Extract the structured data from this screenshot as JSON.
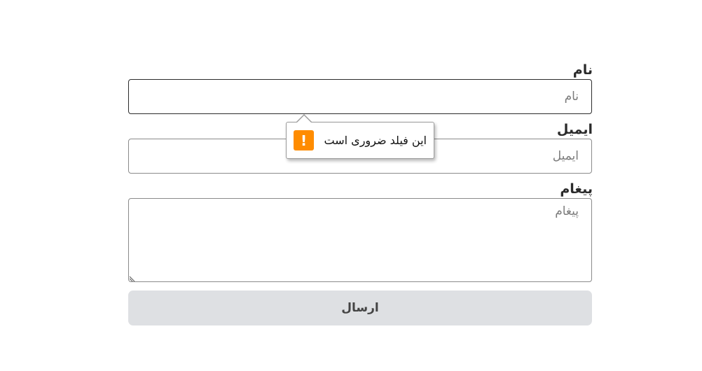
{
  "form": {
    "name": {
      "label": "نام",
      "placeholder": "نام",
      "value": ""
    },
    "email": {
      "label": "ایمیل",
      "placeholder": "ایمیل",
      "value": ""
    },
    "message": {
      "label": "پیغام",
      "placeholder": "پیغام",
      "value": ""
    },
    "submit_label": "ارسال"
  },
  "validation_tooltip": {
    "message": "این فیلد ضروری است",
    "icon": "warning-icon",
    "icon_glyph": "!",
    "icon_color": "#ff8c00"
  },
  "colors": {
    "submit_background": "#dee0e3",
    "warning": "#ff8c00"
  }
}
